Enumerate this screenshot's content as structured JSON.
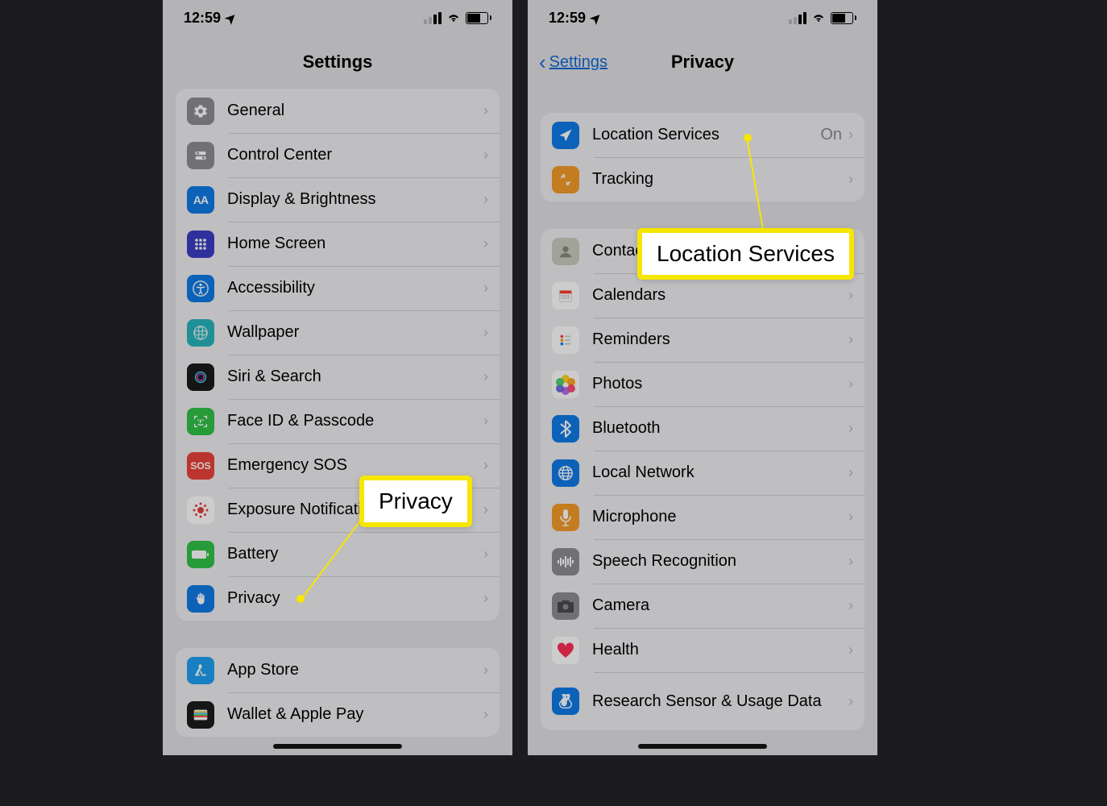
{
  "status": {
    "time": "12:59"
  },
  "left_phone": {
    "nav_title": "Settings",
    "groups": [
      {
        "rows": [
          {
            "icon": "gear-icon",
            "label": "General"
          },
          {
            "icon": "control-center-icon",
            "label": "Control Center"
          },
          {
            "icon": "display-icon",
            "label": "Display & Brightness"
          },
          {
            "icon": "home-screen-icon",
            "label": "Home Screen"
          },
          {
            "icon": "accessibility-icon",
            "label": "Accessibility"
          },
          {
            "icon": "wallpaper-icon",
            "label": "Wallpaper"
          },
          {
            "icon": "siri-icon",
            "label": "Siri & Search"
          },
          {
            "icon": "face-id-icon",
            "label": "Face ID & Passcode"
          },
          {
            "icon": "sos-icon",
            "label": "Emergency SOS"
          },
          {
            "icon": "exposure-icon",
            "label": "Exposure Notifications"
          },
          {
            "icon": "battery-icon",
            "label": "Battery"
          },
          {
            "icon": "privacy-icon",
            "label": "Privacy"
          }
        ]
      },
      {
        "rows": [
          {
            "icon": "app-store-icon",
            "label": "App Store"
          },
          {
            "icon": "wallet-icon",
            "label": "Wallet & Apple Pay"
          }
        ]
      }
    ],
    "callout": "Privacy"
  },
  "right_phone": {
    "back_label": "Settings",
    "nav_title": "Privacy",
    "groups": [
      {
        "rows": [
          {
            "icon": "location-icon",
            "label": "Location Services",
            "value": "On"
          },
          {
            "icon": "tracking-icon",
            "label": "Tracking"
          }
        ]
      },
      {
        "rows": [
          {
            "icon": "contacts-icon",
            "label": "Contacts"
          },
          {
            "icon": "calendars-icon",
            "label": "Calendars"
          },
          {
            "icon": "reminders-icon",
            "label": "Reminders"
          },
          {
            "icon": "photos-icon",
            "label": "Photos"
          },
          {
            "icon": "bluetooth-icon",
            "label": "Bluetooth"
          },
          {
            "icon": "local-network-icon",
            "label": "Local Network"
          },
          {
            "icon": "microphone-icon",
            "label": "Microphone"
          },
          {
            "icon": "speech-icon",
            "label": "Speech Recognition"
          },
          {
            "icon": "camera-icon",
            "label": "Camera"
          },
          {
            "icon": "health-icon",
            "label": "Health"
          },
          {
            "icon": "research-icon",
            "label": "Research Sensor & Usage Data"
          }
        ]
      }
    ],
    "callout": "Location Services"
  }
}
